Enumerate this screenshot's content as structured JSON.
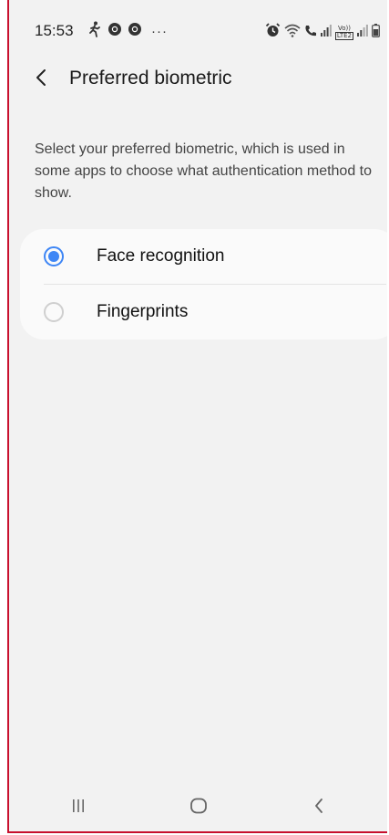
{
  "status_bar": {
    "time": "15:53",
    "left_icons": [
      "walking-person-icon",
      "chrome-icon",
      "chrome-icon",
      "more-dots-icon"
    ],
    "more_dots": "···",
    "right_icons": [
      "alarm-icon",
      "wifi-icon",
      "call-icon",
      "signal-icon",
      "volte-lte-icon",
      "signal-icon",
      "battery-icon"
    ],
    "volte_top": "Vo))",
    "volte_bottom": "LTE2"
  },
  "header": {
    "title": "Preferred biometric",
    "back_icon": "chevron-left-icon"
  },
  "description": "Select your preferred biometric, which is used in some apps to choose what authentication method to show.",
  "options": [
    {
      "label": "Face recognition",
      "selected": true
    },
    {
      "label": "Fingerprints",
      "selected": false
    }
  ],
  "nav_bar": {
    "icons": [
      "recents-icon",
      "home-icon",
      "back-icon"
    ]
  },
  "colors": {
    "accent": "#3e86f5",
    "background": "#f2f2f2",
    "card": "#fafafa",
    "frame_border": "#c8102e"
  }
}
